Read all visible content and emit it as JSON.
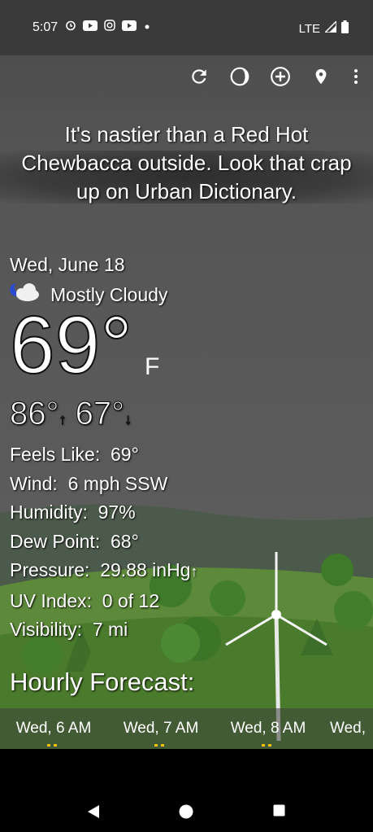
{
  "status_bar": {
    "time": "5:07",
    "network": "LTE",
    "icons": [
      "alarm-icon",
      "youtube-icon",
      "instagram-icon",
      "youtube-icon",
      "dot-icon"
    ]
  },
  "toolbar": {
    "icons": [
      "refresh-icon",
      "theme-icon",
      "add-location-icon",
      "location-pin-icon",
      "more-vert-icon"
    ]
  },
  "headline": "It's nastier than a Red Hot Chewbacca outside. Look that crap up on Urban Dictionary.",
  "weather": {
    "date": "Wed, June 18",
    "condition": "Mostly Cloudy",
    "temperature": "69°",
    "unit": "F",
    "high": "86°",
    "low": "67°",
    "details": [
      {
        "label": "Feels Like:",
        "value": "69°"
      },
      {
        "label": "Wind:",
        "value": "6 mph SSW"
      },
      {
        "label": "Humidity:",
        "value": "97%"
      },
      {
        "label": "Dew Point:",
        "value": "68°"
      },
      {
        "label": "Pressure:",
        "value": "29.88 inHg"
      },
      {
        "label": "UV Index:",
        "value": "0 of 12"
      },
      {
        "label": "Visibility:",
        "value": "7 mi"
      }
    ]
  },
  "hourly": {
    "title": "Hourly Forecast:",
    "hours": [
      "Wed, 6 AM",
      "Wed, 7 AM",
      "Wed, 8 AM",
      "Wed,"
    ]
  },
  "colors": {
    "sky": "#555555",
    "grass": "#4f7a2c",
    "tree": "#3f7a2a"
  }
}
